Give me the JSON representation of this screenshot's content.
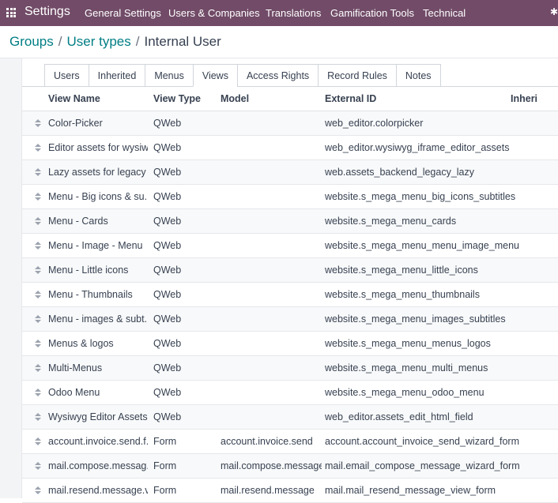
{
  "navbar": {
    "app_name": "Settings",
    "menu": [
      "General Settings",
      "Users & Companies",
      "Translations",
      "Gamification Tools",
      "Technical"
    ]
  },
  "breadcrumb": {
    "items": [
      "Groups",
      "User types"
    ],
    "current": "Internal User"
  },
  "tabs": [
    "Users",
    "Inherited",
    "Menus",
    "Views",
    "Access Rights",
    "Record Rules",
    "Notes"
  ],
  "active_tab": "Views",
  "table": {
    "headers": [
      "View Name",
      "View Type",
      "Model",
      "External ID",
      "Inheri"
    ],
    "rows": [
      {
        "name": "Color-Picker",
        "type": "QWeb",
        "model": "",
        "ext": "web_editor.colorpicker"
      },
      {
        "name": "Editor assets for wysiw...",
        "type": "QWeb",
        "model": "",
        "ext": "web_editor.wysiwyg_iframe_editor_assets"
      },
      {
        "name": "Lazy assets for legacy ...",
        "type": "QWeb",
        "model": "",
        "ext": "web.assets_backend_legacy_lazy"
      },
      {
        "name": "Menu - Big icons & su...",
        "type": "QWeb",
        "model": "",
        "ext": "website.s_mega_menu_big_icons_subtitles"
      },
      {
        "name": "Menu - Cards",
        "type": "QWeb",
        "model": "",
        "ext": "website.s_mega_menu_cards"
      },
      {
        "name": "Menu - Image - Menu",
        "type": "QWeb",
        "model": "",
        "ext": "website.s_mega_menu_menu_image_menu"
      },
      {
        "name": "Menu - Little icons",
        "type": "QWeb",
        "model": "",
        "ext": "website.s_mega_menu_little_icons"
      },
      {
        "name": "Menu - Thumbnails",
        "type": "QWeb",
        "model": "",
        "ext": "website.s_mega_menu_thumbnails"
      },
      {
        "name": "Menu - images & subt...",
        "type": "QWeb",
        "model": "",
        "ext": "website.s_mega_menu_images_subtitles"
      },
      {
        "name": "Menus & logos",
        "type": "QWeb",
        "model": "",
        "ext": "website.s_mega_menu_menus_logos"
      },
      {
        "name": "Multi-Menus",
        "type": "QWeb",
        "model": "",
        "ext": "website.s_mega_menu_multi_menus"
      },
      {
        "name": "Odoo Menu",
        "type": "QWeb",
        "model": "",
        "ext": "website.s_mega_menu_odoo_menu"
      },
      {
        "name": "Wysiwyg Editor Assets...",
        "type": "QWeb",
        "model": "",
        "ext": "web_editor.assets_edit_html_field"
      },
      {
        "name": "account.invoice.send.f...",
        "type": "Form",
        "model": "account.invoice.send",
        "ext": "account.account_invoice_send_wizard_form"
      },
      {
        "name": "mail.compose.messag...",
        "type": "Form",
        "model": "mail.compose.message",
        "ext": "mail.email_compose_message_wizard_form"
      },
      {
        "name": "mail.resend.message.v...",
        "type": "Form",
        "model": "mail.resend.message",
        "ext": "mail.mail_resend_message_view_form"
      }
    ]
  },
  "colors": {
    "navbar": "#714b67",
    "link": "#017e84"
  }
}
